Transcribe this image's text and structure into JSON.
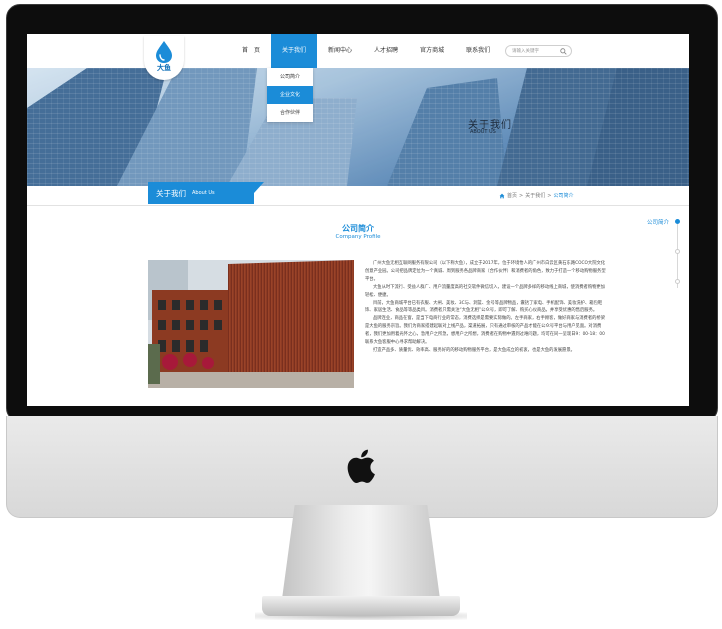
{
  "logo": {
    "text": "大鱼"
  },
  "nav": {
    "items": [
      {
        "label": "首　页",
        "active": false
      },
      {
        "label": "关于我们",
        "active": true
      },
      {
        "label": "新闻中心",
        "active": false
      },
      {
        "label": "人才招聘",
        "active": false
      },
      {
        "label": "官方商城",
        "active": false
      },
      {
        "label": "联系我们",
        "active": false
      }
    ],
    "search_placeholder": "请输入关键字"
  },
  "dropdown": {
    "items": [
      {
        "label": "公司简介",
        "active": false
      },
      {
        "label": "企业文化",
        "active": true
      },
      {
        "label": "合作伙伴",
        "active": false
      }
    ]
  },
  "banner": {
    "title": "关于我们",
    "subtitle": "ABOUT US"
  },
  "section": {
    "title_cn": "关于我们",
    "title_en": "About Us"
  },
  "breadcrumb": {
    "home": "首页",
    "sep1": ">",
    "parent": "关于我们",
    "sep2": ">",
    "current": "公司简介"
  },
  "content": {
    "title": "公司简介",
    "subtitle": "Company Profile",
    "paragraphs": [
      "广州大鱼无相互联网服务有限公司（以下称大鱼），成立于2017年，位于环境怡人的广州市白云区黄石东路COCO大院文化创意产业园。公司把品牌定位为一个真诚、周到服务各品牌商家（合作伙伴）和消费者的角色，致力于打造一个移动购物服务型平台。",
      "大鱼从时下流行、受益人群广、用户流量度高的社交软件微信切入，建设一个品牌多样的移动线上商城，使消费者购物更加轻松、便捷。",
      "目前，大鱼商城平台已有衣服、大闸、美妆、3C与、洞篮、金号等品牌物品，囊括了家电、手机配饰、美妆洗护、箱包鞋饰、家居生活、食品等等品类目。消费者只需关注“大鱼无相”公众号，即可了解、购买心仪商品，并享受优惠的售后服务。",
      "品牌连业，商品在窗，是当下电商行业的常态，消费选择是需要实际做的。左手商家，右手顾客，做好商家与消费者的桥梁是大鱼的服务宗旨。我们为商家搭建起联对上线产品，渠道拓展，只有通过审核的产品才能在公众号平台与用户见面。对消费者，我们更加用着光怀之心，急用户之所急，想用户之所想，消费者在购物中遇到过难问题，均可在同一呈现日9：00-18：00联系大鱼客服中心寻求帮助解决。",
      "打造产品多、质量优、效率高、服务好的的移动购物服务平台，是大鱼成立的初衷，也是大鱼的发展愿景。"
    ]
  },
  "side_nav": {
    "label": "公司简介",
    "dots": 3,
    "active_index": 0
  },
  "colors": {
    "accent": "#1b8cd8",
    "brand": "#0f6fb8"
  },
  "icons": {
    "search": "search-icon",
    "home": "home-icon",
    "apple": "apple-logo-icon",
    "logo": "water-drop-icon"
  }
}
